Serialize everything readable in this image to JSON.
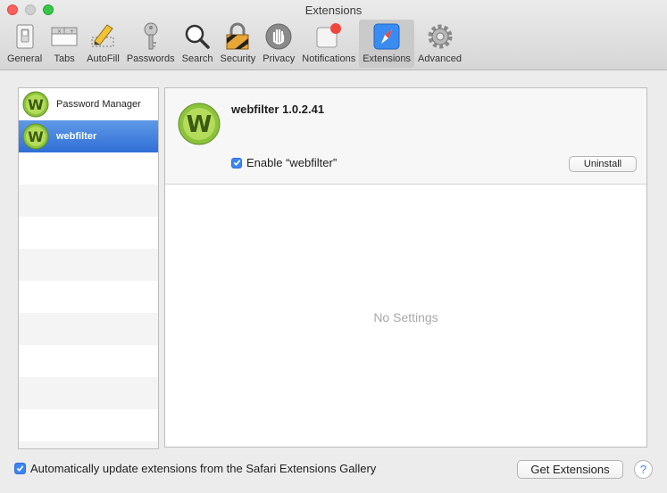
{
  "window": {
    "title": "Extensions"
  },
  "toolbar": {
    "items": [
      {
        "label": "General",
        "icon": "general-switch-icon"
      },
      {
        "label": "Tabs",
        "icon": "tabs-icon"
      },
      {
        "label": "AutoFill",
        "icon": "autofill-pencil-icon"
      },
      {
        "label": "Passwords",
        "icon": "key-icon"
      },
      {
        "label": "Search",
        "icon": "magnifier-icon"
      },
      {
        "label": "Security",
        "icon": "padlock-icon"
      },
      {
        "label": "Privacy",
        "icon": "hand-icon"
      },
      {
        "label": "Notifications",
        "icon": "notification-badge-icon"
      },
      {
        "label": "Extensions",
        "icon": "compass-icon"
      },
      {
        "label": "Advanced",
        "icon": "gear-icon"
      }
    ],
    "active": "Extensions"
  },
  "sidebar": {
    "items": [
      {
        "label": "Password Manager",
        "icon": "webfilter-logo-icon"
      },
      {
        "label": "webfilter",
        "icon": "webfilter-logo-icon",
        "selected": true
      }
    ]
  },
  "detail": {
    "title": "webfilter 1.0.2.41",
    "enable_label": "Enable “webfilter”",
    "enabled": true,
    "uninstall_label": "Uninstall",
    "empty_text": "No Settings"
  },
  "footer": {
    "auto_update_label": "Automatically update extensions from the Safari Extensions Gallery",
    "auto_update_checked": true,
    "get_extensions_label": "Get Extensions",
    "help_label": "?"
  },
  "colors": {
    "accent": "#3c86f4",
    "selection": "#2f6ed6",
    "logo_green": "#8cc33c"
  }
}
